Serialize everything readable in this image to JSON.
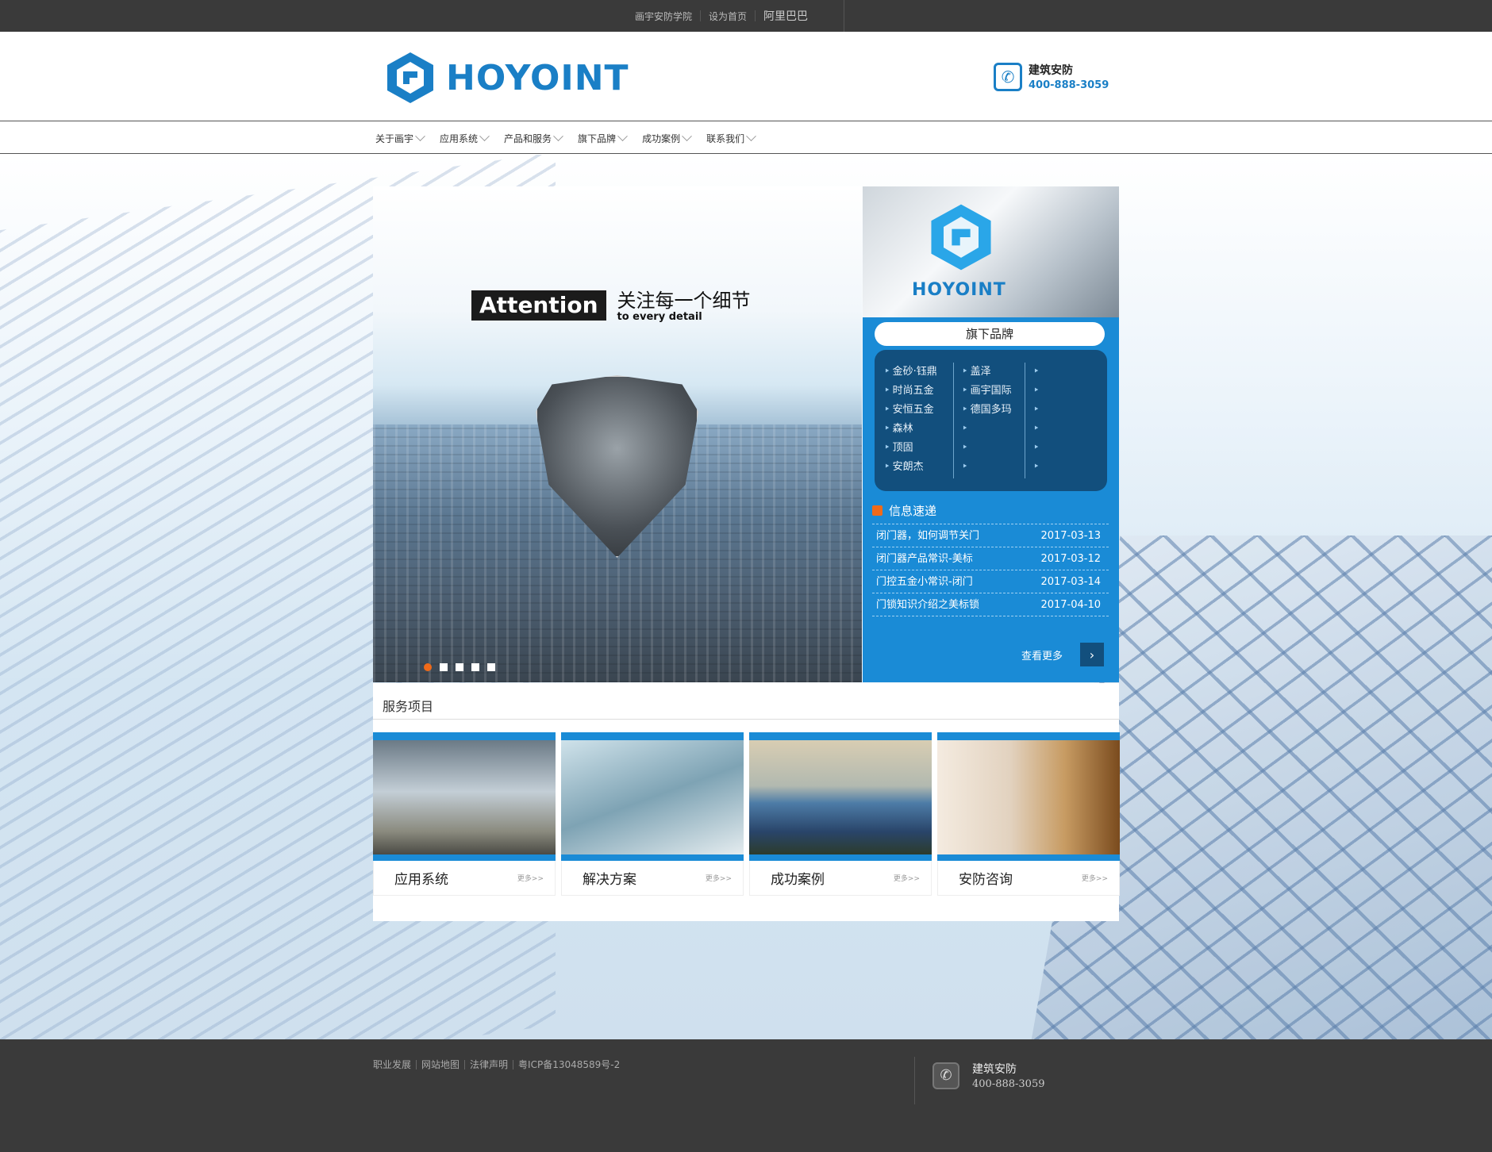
{
  "topbar": {
    "links": [
      "画宇安防学院",
      "设为首页",
      "阿里巴巴"
    ]
  },
  "header": {
    "logo_text": "HOYOINT",
    "hotline_title": "建筑安防",
    "hotline_number": "400-888-3059"
  },
  "nav": {
    "items": [
      "关于画宇",
      "应用系统",
      "产品和服务",
      "旗下品牌",
      "成功案例",
      "联系我们"
    ]
  },
  "banner": {
    "badge": "Attention",
    "headline_cn": "关注每一个细节",
    "headline_en": "to every detail"
  },
  "side": {
    "brand_logo_text": "HOYOINT",
    "brands_title": "旗下品牌",
    "brands_col1": [
      "金砂·钰鼎",
      "时尚五金",
      "安恒五金",
      "森林",
      "顶固",
      "安朗杰"
    ],
    "brands_col2": [
      "盖泽",
      "画宇国际",
      "德国多玛",
      "",
      "",
      ""
    ],
    "brands_col3": [
      "",
      "",
      "",
      "",
      "",
      ""
    ],
    "news_title": "信息速递",
    "news": [
      {
        "title": "闭门器，如何调节关门",
        "date": "2017-03-13"
      },
      {
        "title": "闭门器产品常识-美标",
        "date": "2017-03-12"
      },
      {
        "title": "门控五金小常识-闭门",
        "date": "2017-03-14"
      },
      {
        "title": "门锁知识介绍之美标锁",
        "date": "2017-04-10"
      }
    ],
    "more_label": "查看更多"
  },
  "services": {
    "title": "服务项目",
    "cards": [
      {
        "name": "应用系统",
        "more": "更多>>"
      },
      {
        "name": "解决方案",
        "more": "更多>>"
      },
      {
        "name": "成功案例",
        "more": "更多>>"
      },
      {
        "name": "安防咨询",
        "more": "更多>>"
      }
    ]
  },
  "footer": {
    "links": [
      "职业发展",
      "网站地图",
      "法律声明",
      "粤ICP备13048589号-2"
    ],
    "contact_title": "建筑安防",
    "contact_number": "400-888-3059"
  },
  "colors": {
    "brand_blue": "#1a7fc6",
    "panel_blue": "#1a8bd6",
    "panel_dark": "#124f7d",
    "bar_dark": "#3a3a3a",
    "accent_orange": "#f06a19"
  },
  "icons": {
    "hotline": "phone-icon",
    "news": "rss-icon",
    "more": "chevron-right-icon",
    "footer": "phone-icon"
  }
}
